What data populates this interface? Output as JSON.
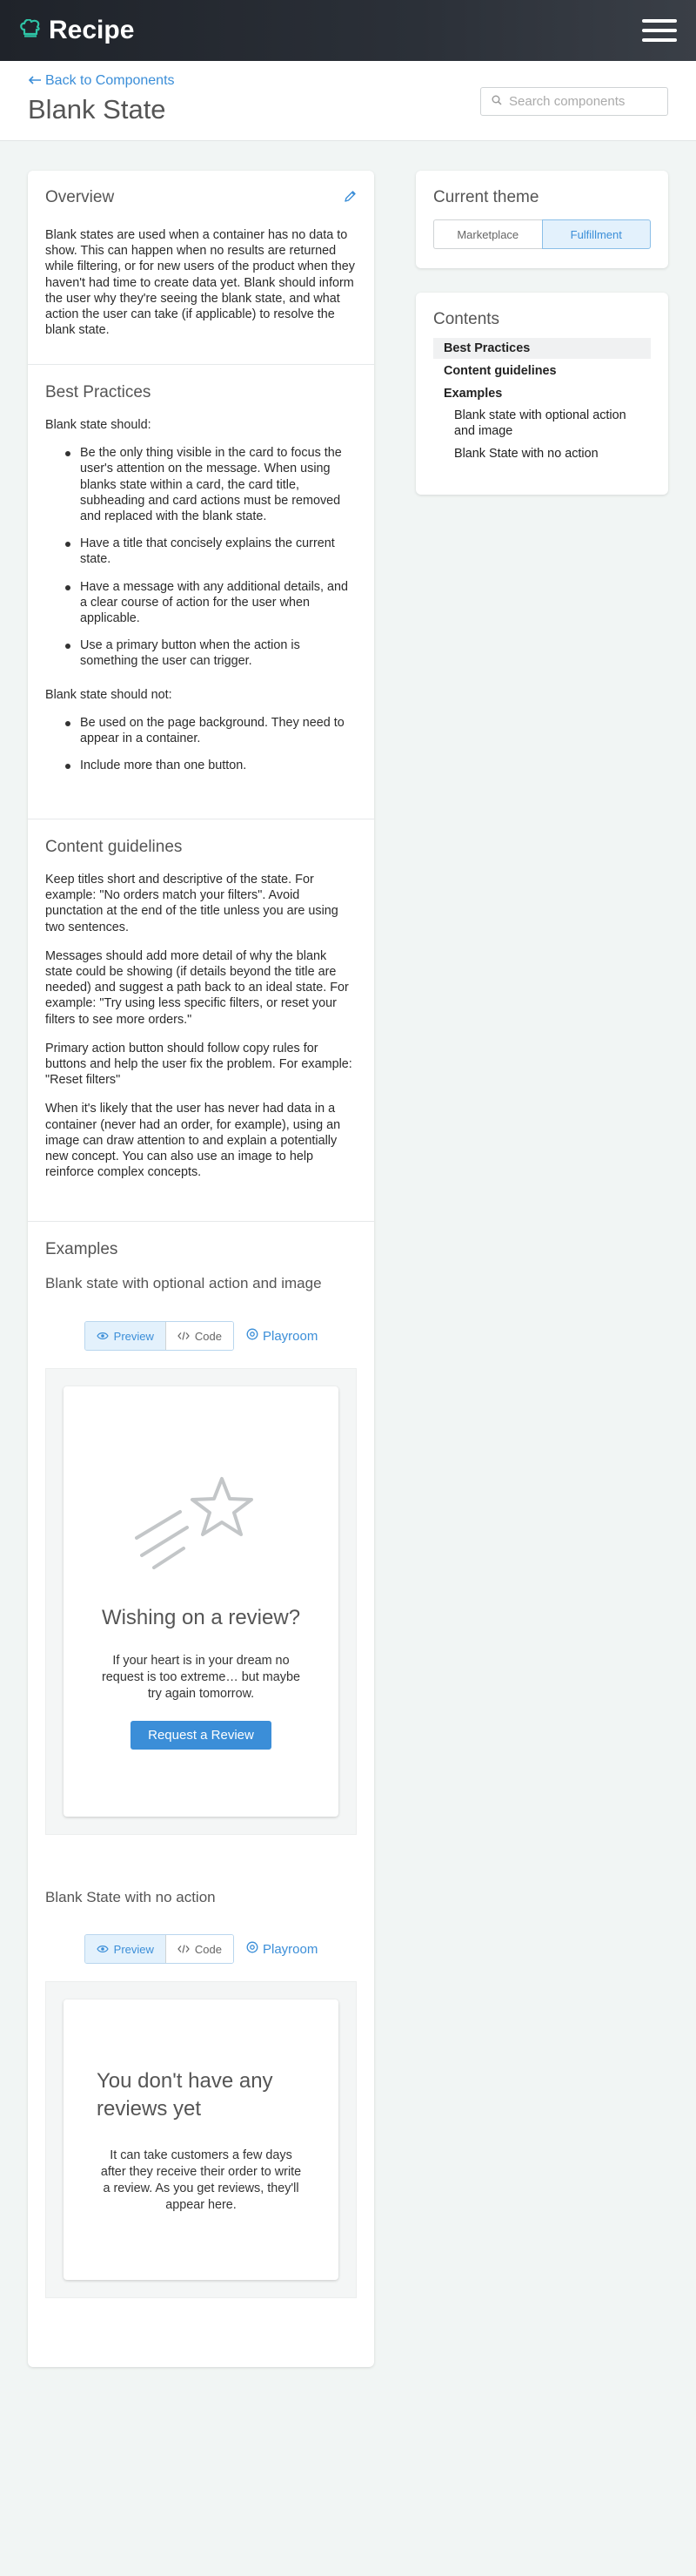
{
  "topbar": {
    "logo_text": "Recipe",
    "logo_icon": "chef-hat-icon",
    "menu_icon": "hamburger-icon"
  },
  "header": {
    "back_link": "Back to Components",
    "title": "Blank State",
    "search_placeholder": "Search components"
  },
  "overview": {
    "heading": "Overview",
    "body": "Blank states are used when a container has no data to show. This can happen when no results are returned while filtering, or for new users of the product when they haven't had time to create data yet. Blank should inform the user why they're seeing the blank state, and what action the user can take (if applicable) to resolve the blank state."
  },
  "best_practices": {
    "heading": "Best Practices",
    "should_label": "Blank state should:",
    "should": [
      "Be the only thing visible in the card to focus the user's attention on the message. When using blanks state within a card, the card title, subheading and card actions must be removed and replaced with the blank state.",
      "Have a title that concisely explains the current state.",
      "Have a message with any additional details, and a clear course of action for the user when applicable.",
      "Use a primary button when the action is something the user can trigger."
    ],
    "should_not_label": "Blank state should not:",
    "should_not": [
      "Be used on the page background. They need to appear in a container.",
      "Include more than one button."
    ]
  },
  "content_guidelines": {
    "heading": "Content guidelines",
    "paragraphs": [
      "Keep titles short and descriptive of the state. For example: \"No orders match your filters\". Avoid punctation at the end of the title unless you are using two sentences.",
      "Messages should add more detail of why the blank state could be showing (if details beyond the title are needed) and suggest a path back to an ideal state. For example: \"Try using less specific filters, or reset your filters to see more orders.\"",
      "Primary action button should follow copy rules for buttons and help the user fix the problem. For example: \"Reset filters\"",
      "When it's likely that the user has never had data in a container (never had an order, for example), using an image can draw attention to and explain a potentially new concept. You can also use an image to help reinforce complex concepts."
    ]
  },
  "examples": {
    "heading": "Examples",
    "tabs": {
      "preview": "Preview",
      "code": "Code",
      "playroom": "Playroom"
    },
    "example1": {
      "title": "Blank state with optional action and image",
      "card_title": "Wishing on a review?",
      "card_message": "If your heart is in your dream no request is too extreme… but maybe try again tomorrow.",
      "button": "Request a Review"
    },
    "example2": {
      "title": "Blank State with no action",
      "card_title": "You don't have any reviews yet",
      "card_message": "It can take customers a few days after they receive their order to write a review. As you get reviews, they'll appear here."
    }
  },
  "theme": {
    "heading": "Current theme",
    "options": [
      "Marketplace",
      "Fulfillment"
    ],
    "selected": "Fulfillment"
  },
  "contents": {
    "heading": "Contents",
    "items": [
      {
        "label": "Best Practices",
        "level": 1
      },
      {
        "label": "Content guidelines",
        "level": 1
      },
      {
        "label": "Examples",
        "level": 1
      },
      {
        "label": "Blank state with optional action and image",
        "level": 2
      },
      {
        "label": "Blank State with no action",
        "level": 2
      }
    ]
  },
  "colors": {
    "accent": "#3b8ed8",
    "topbar": "#2b3038",
    "logo_green": "#2ec4a6",
    "background": "#f1f5f4"
  }
}
